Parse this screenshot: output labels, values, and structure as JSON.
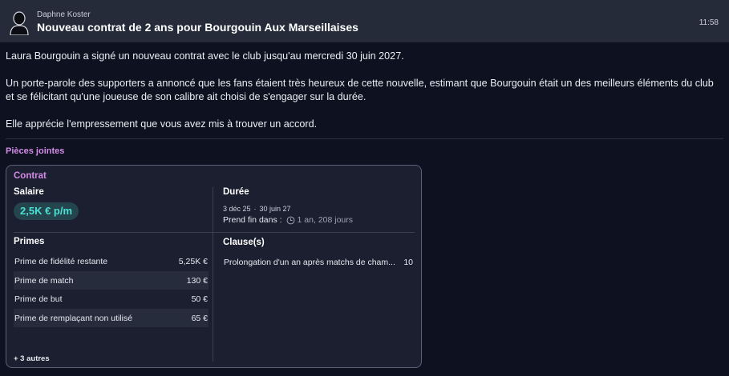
{
  "header": {
    "sender": "Daphne Koster",
    "subject": "Nouveau contrat de 2 ans pour Bourgouin Aux Marseillaises",
    "time": "11:58",
    "avatar_icon": "person-silhouette-icon"
  },
  "body": {
    "paragraphs": [
      "Laura Bourgouin a signé un nouveau contrat avec le club jusqu'au mercredi 30 juin 2027.",
      "Un porte-parole des supporters a annoncé que les fans étaient très heureux de cette nouvelle, estimant que Bourgouin était un des meilleurs éléments du club et se félicitant qu'une joueuse de son calibre ait choisi de s'engager sur la durée.",
      "Elle apprécie l'empressement que vous avez mis à trouver un accord."
    ]
  },
  "attachments": {
    "title": "Pièces jointes",
    "contract": {
      "title": "Contrat",
      "salary_label": "Salaire",
      "salary_value": "2,5K € p/m",
      "duration_label": "Durée",
      "start_date": "3 déc 25",
      "separator": "·",
      "end_date": "30 juin 27",
      "ends_in_label": "Prend fin dans :",
      "ends_in_value": "1 an, 208 jours",
      "bonuses_label": "Primes",
      "bonuses": [
        {
          "label": "Prime de fidélité restante",
          "value": "5,25K €"
        },
        {
          "label": "Prime de match",
          "value": "130 €"
        },
        {
          "label": "Prime de but",
          "value": "50 €"
        },
        {
          "label": "Prime de remplaçant non utilisé",
          "value": "65 €"
        }
      ],
      "more": "+ 3 autres",
      "clauses_label": "Clause(s)",
      "clauses": [
        {
          "label": "Prolongation d'un an après matchs de cham...",
          "value": "10"
        }
      ]
    }
  },
  "colors": {
    "background": "#0d1120",
    "header": "#262b3a",
    "accent_pink": "#d38be6",
    "salary_teal": "#4be0d4",
    "card": "#1b1f30"
  }
}
